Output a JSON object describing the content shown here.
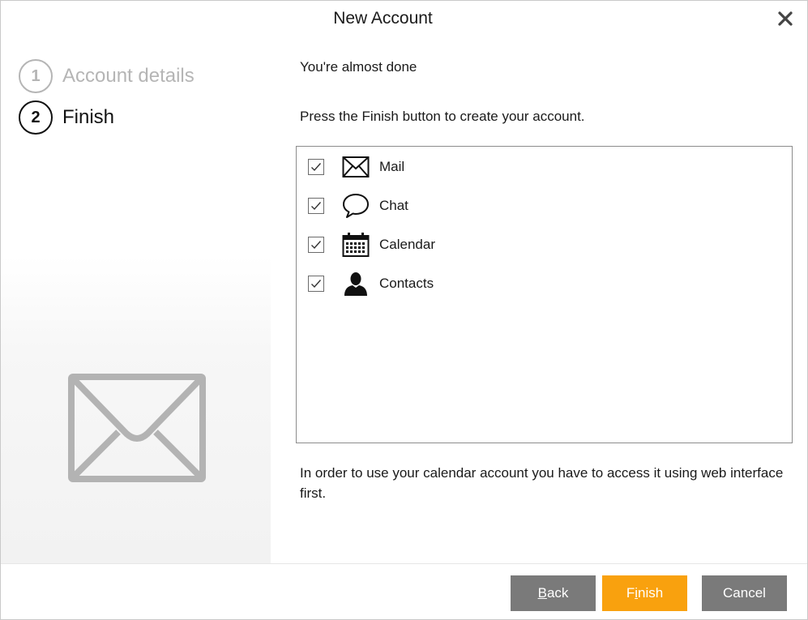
{
  "window": {
    "title": "New Account"
  },
  "steps": [
    {
      "number": "1",
      "label": "Account details",
      "state": "done"
    },
    {
      "number": "2",
      "label": "Finish",
      "state": "active"
    }
  ],
  "content": {
    "heading": "You're almost done",
    "instruction": "Press the Finish button to create your account.",
    "services": [
      {
        "label": "Mail",
        "checked": true,
        "icon": "mail-icon"
      },
      {
        "label": "Chat",
        "checked": true,
        "icon": "chat-bubble-icon"
      },
      {
        "label": "Calendar",
        "checked": true,
        "icon": "calendar-icon"
      },
      {
        "label": "Contacts",
        "checked": true,
        "icon": "person-icon"
      }
    ],
    "note": "In order to use your calendar account you have to access it using web interface first."
  },
  "buttons": {
    "back": {
      "pre": "",
      "mnemonic": "B",
      "post": "ack"
    },
    "finish": {
      "pre": "F",
      "mnemonic": "i",
      "post": "nish"
    },
    "cancel": "Cancel"
  },
  "colors": {
    "accent": "#f9a10e",
    "button_gray": "#7a7a7a",
    "inactive_step": "#b5b5b5"
  }
}
